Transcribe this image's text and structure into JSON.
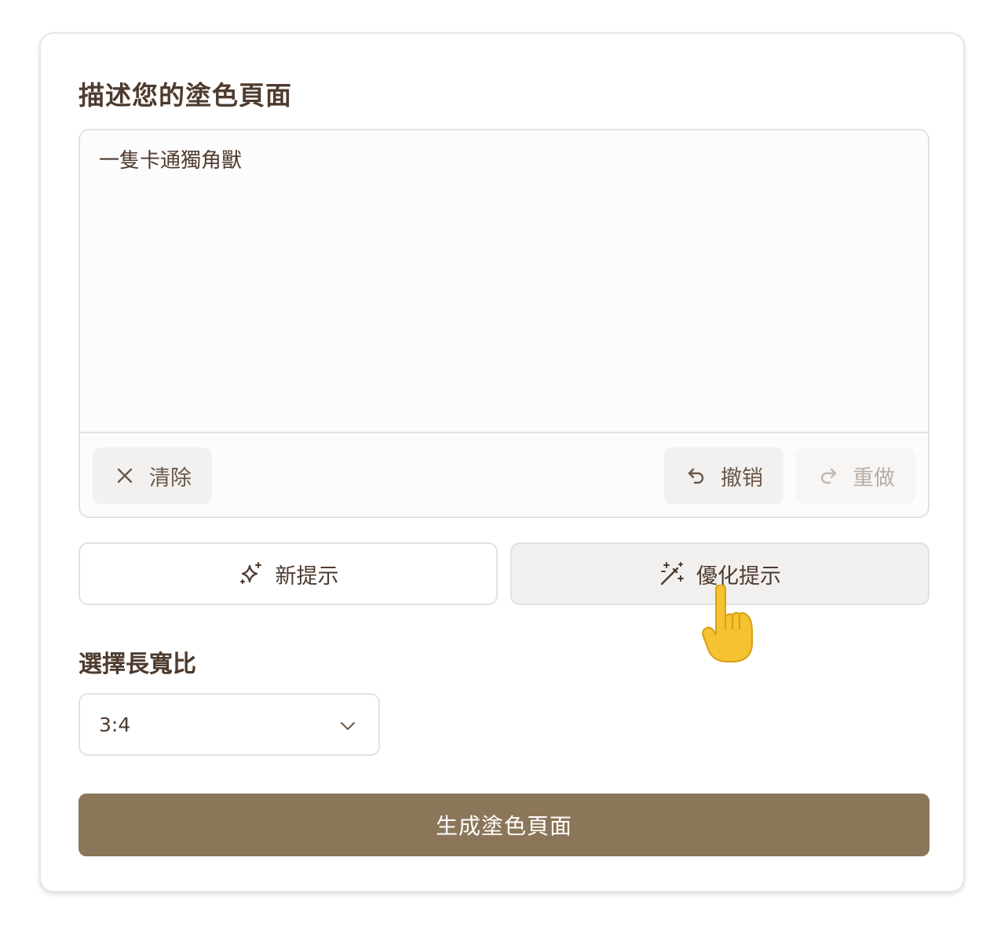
{
  "form": {
    "title": "描述您的塗色頁面",
    "prompt_value": "一隻卡通獨角獸",
    "toolbar": {
      "clear_label": "清除",
      "undo_label": "撤销",
      "redo_label": "重做"
    },
    "new_prompt_label": "新提示",
    "optimize_prompt_label": "優化提示",
    "aspect_label": "選擇長寬比",
    "aspect_value": "3:4",
    "generate_label": "生成塗色頁面"
  },
  "icons": {
    "clear": "close-icon",
    "undo": "undo-icon",
    "redo": "redo-icon",
    "new_prompt": "sparkles-icon",
    "optimize": "magic-wand-icon",
    "dropdown": "chevron-down-icon",
    "cursor": "pointing-hand-icon"
  },
  "colors": {
    "primary_button": "#8b7659",
    "text": "#4e3b2f",
    "disabled_text": "#b9aea4"
  }
}
